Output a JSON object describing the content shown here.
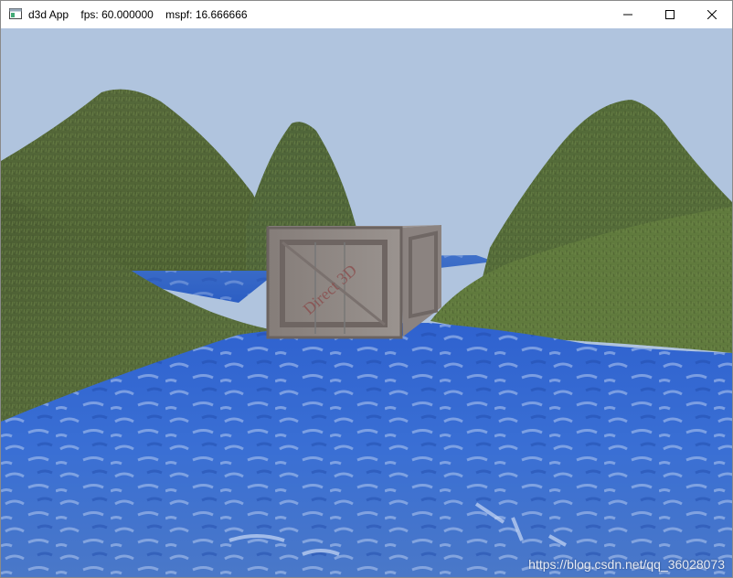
{
  "window": {
    "title_app": "d3d App",
    "title_fps": "fps: 60.000000",
    "title_mspf": "mspf: 16.666666"
  },
  "scene": {
    "crate_label": "Direct 3D",
    "watermark": "https://blog.csdn.net/qq_36028073"
  },
  "colors": {
    "sky": "#b0c4de",
    "water": "#3b6fd0",
    "grass": "#5b7138",
    "crate": "#8a8280"
  }
}
